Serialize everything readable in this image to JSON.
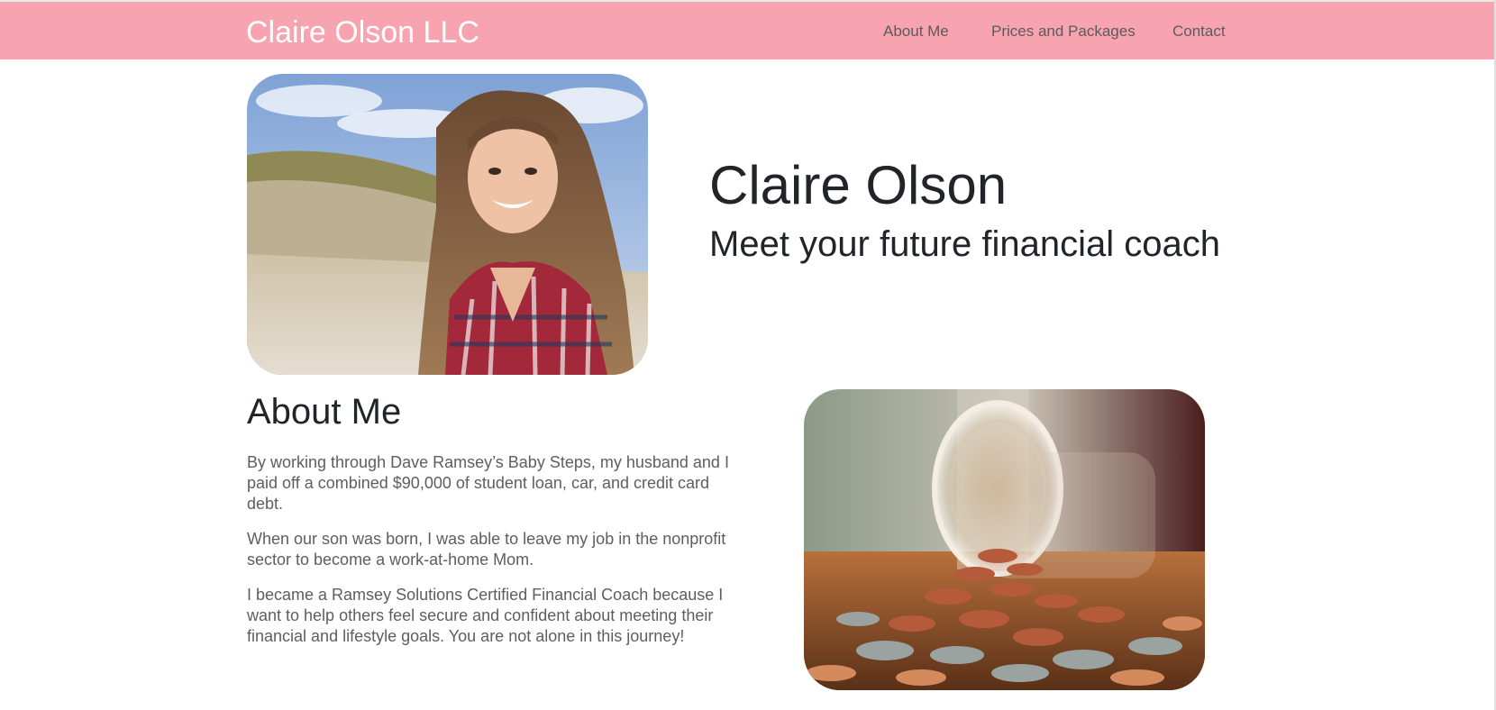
{
  "navbar": {
    "brand": "Claire Olson LLC",
    "links": [
      "About Me",
      "Prices and Packages",
      "Contact"
    ],
    "background_color": "#f7a4b0"
  },
  "hero": {
    "name": "Claire Olson",
    "subtitle": "Meet your future financial coach",
    "image_icon": "portrait-photo"
  },
  "about": {
    "heading": "About Me",
    "paragraphs": [
      "By working through Dave Ramsey’s Baby Steps, my husband and I paid off a combined $90,000 of student loan, car, and credit card debt.",
      "When our son was born, I was able to leave my job in the nonprofit sector to become a work-at-home Mom.",
      "I became a Ramsey Solutions Certified Financial Coach because I want to help others feel secure and confident about meeting their financial and lifestyle goals. You are not alone in this journey!"
    ],
    "image_icon": "coin-jar-photo"
  }
}
